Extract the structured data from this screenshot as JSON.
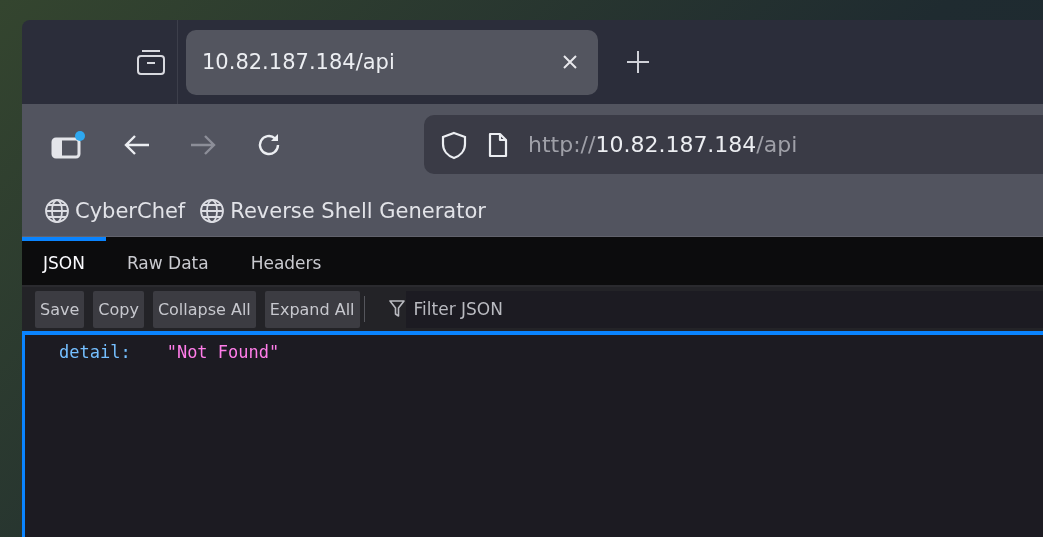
{
  "tabs": [
    {
      "title": "10.82.187.184/api",
      "selected": true
    }
  ],
  "address": {
    "scheme": "http://",
    "host": "10.82.187.184",
    "path": "/api"
  },
  "bookmarks": [
    {
      "label": "CyberChef"
    },
    {
      "label": "Reverse Shell Generator"
    }
  ],
  "viewer_tabs": [
    {
      "label": "JSON",
      "selected": true
    },
    {
      "label": "Raw Data",
      "selected": false
    },
    {
      "label": "Headers",
      "selected": false
    }
  ],
  "viewer_buttons": [
    "Save",
    "Copy",
    "Collapse All",
    "Expand All"
  ],
  "filter": {
    "placeholder": "Filter JSON"
  },
  "json_rows": [
    {
      "key": "detail:",
      "value": "\"Not Found\""
    }
  ]
}
